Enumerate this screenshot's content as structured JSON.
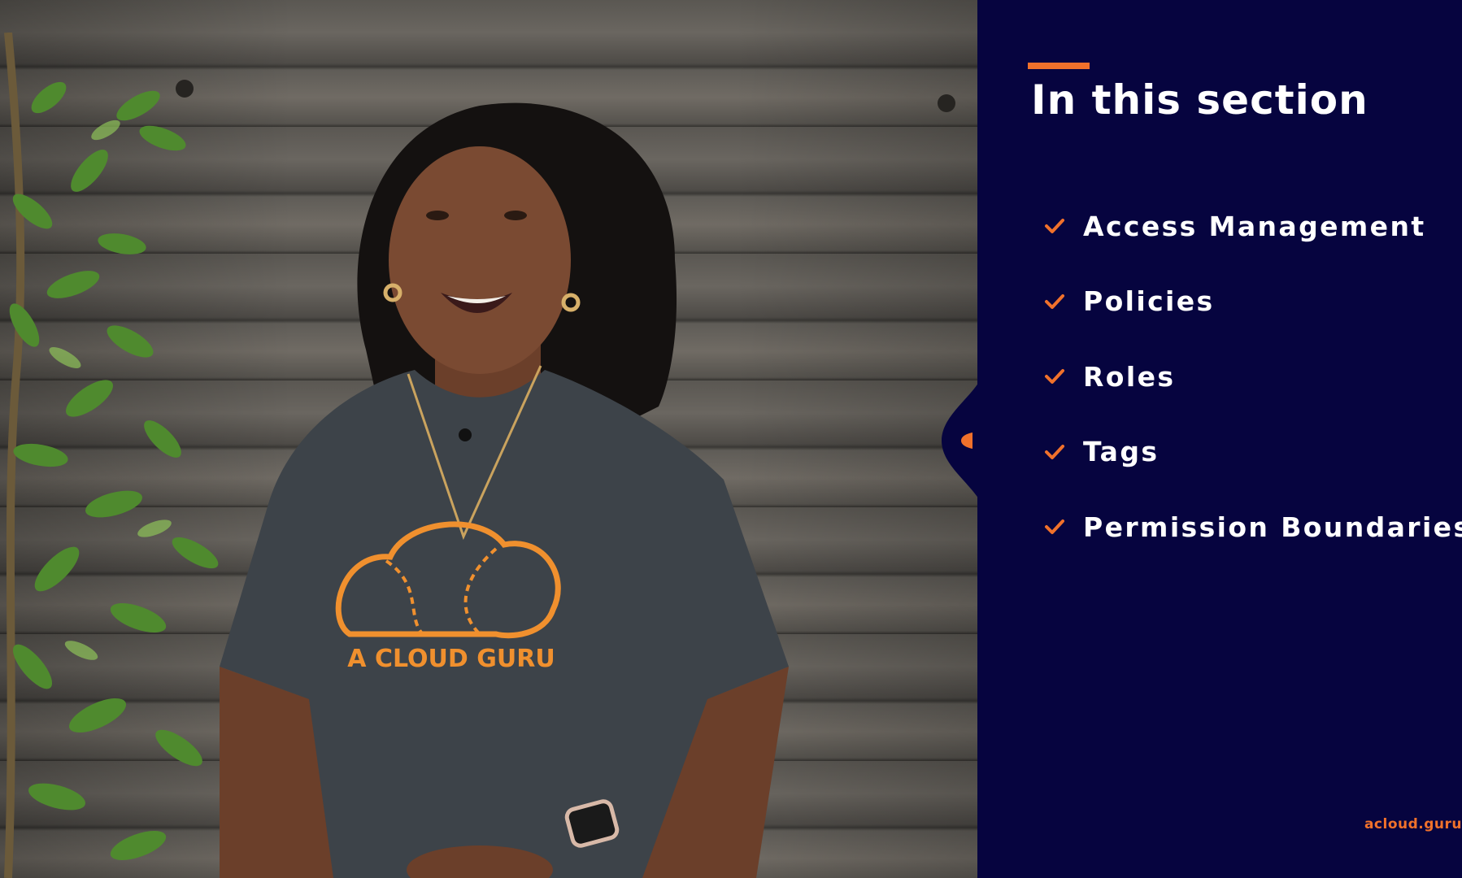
{
  "video": {
    "shirt_logo_text": "A CLOUD GURU"
  },
  "slide": {
    "title": "In this section",
    "topics": [
      {
        "label": "Access Management",
        "icon": "check-icon"
      },
      {
        "label": "Policies",
        "icon": "check-icon"
      },
      {
        "label": "Roles",
        "icon": "check-icon"
      },
      {
        "label": "Tags",
        "icon": "check-icon"
      },
      {
        "label": "Permission Boundaries",
        "icon": "check-icon"
      }
    ],
    "brand": "acloud.guru"
  },
  "colors": {
    "panel_background": "#06043f",
    "accent": "#f0712b",
    "text": "#ffffff"
  }
}
